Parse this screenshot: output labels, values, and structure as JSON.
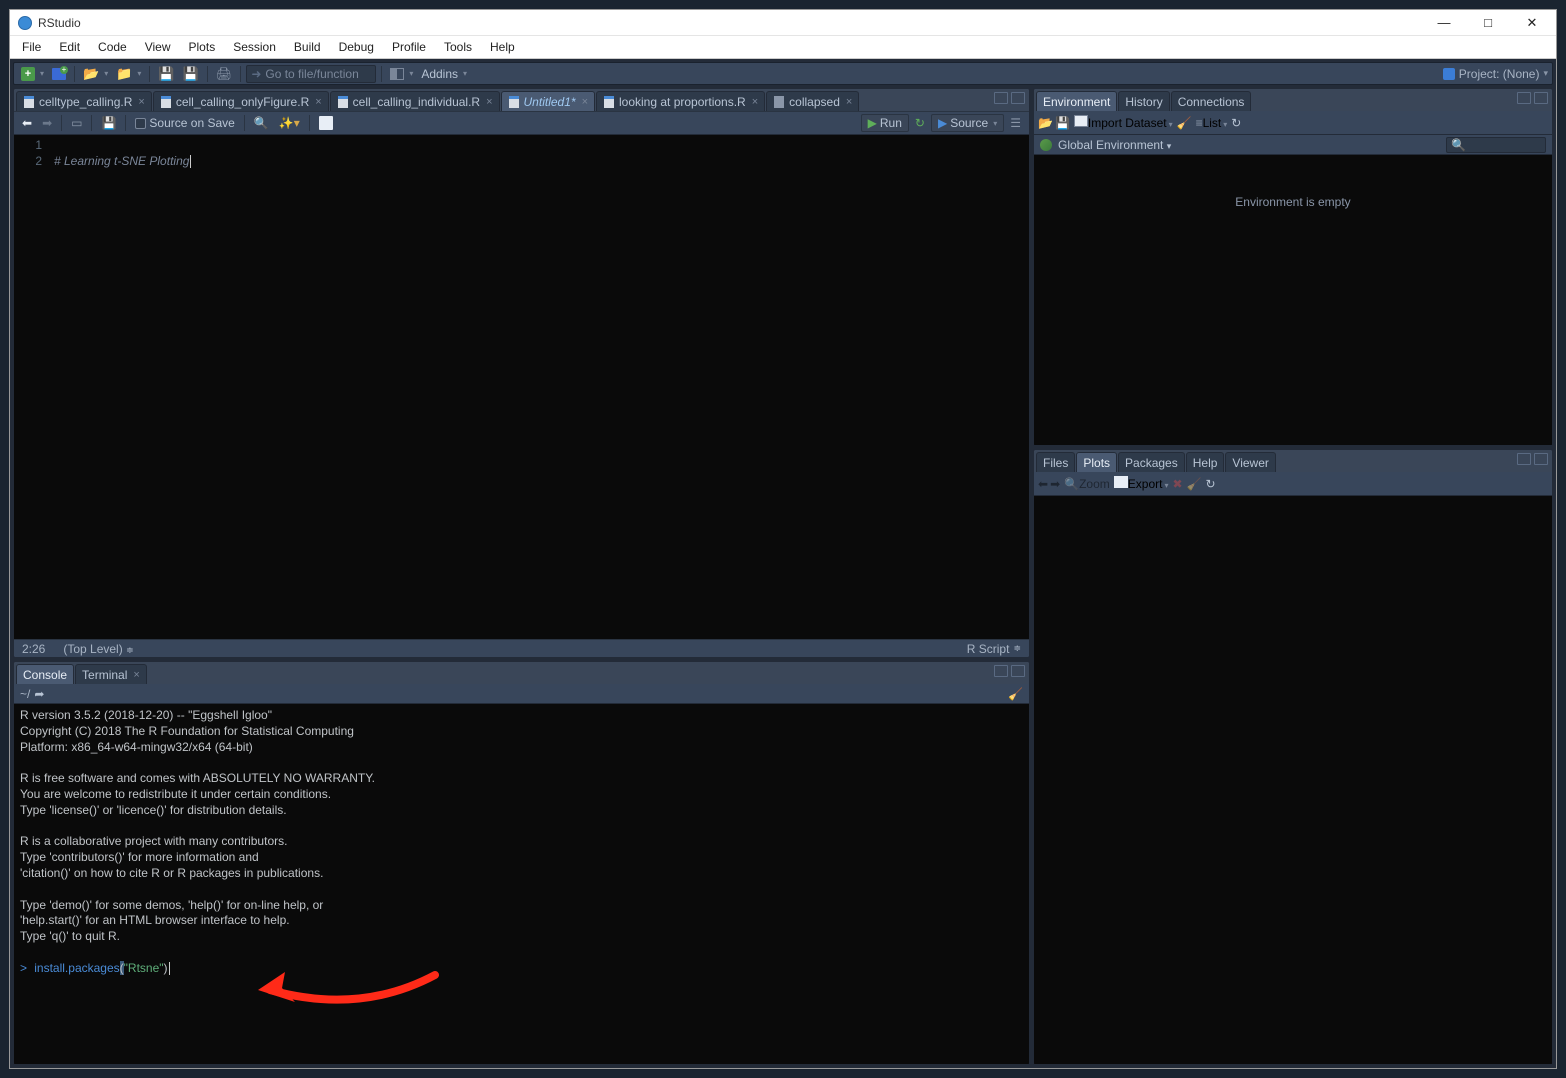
{
  "window": {
    "title": "RStudio"
  },
  "menu": [
    "File",
    "Edit",
    "Code",
    "View",
    "Plots",
    "Session",
    "Build",
    "Debug",
    "Profile",
    "Tools",
    "Help"
  ],
  "toolbar": {
    "goto_placeholder": "Go to file/function",
    "addins": "Addins",
    "project_label": "Project: (None)"
  },
  "editor": {
    "tabs": [
      {
        "label": "celltype_calling.R"
      },
      {
        "label": "cell_calling_onlyFigure.R"
      },
      {
        "label": "cell_calling_individual.R"
      },
      {
        "label": "Untitled1*",
        "active": true
      },
      {
        "label": "looking at proportions.R"
      },
      {
        "label": "collapsed",
        "collapsed": true
      }
    ],
    "source_on_save": "Source on Save",
    "run_label": "Run",
    "source_label": "Source",
    "line_numbers": [
      "1",
      "2"
    ],
    "code_line": "# Learning t-SNE Plotting",
    "status_pos": "2:26",
    "status_scope": "(Top Level)",
    "status_lang": "R Script"
  },
  "console": {
    "tabs": [
      "Console",
      "Terminal"
    ],
    "path": "~/",
    "banner": "R version 3.5.2 (2018-12-20) -- \"Eggshell Igloo\"\nCopyright (C) 2018 The R Foundation for Statistical Computing\nPlatform: x86_64-w64-mingw32/x64 (64-bit)\n\nR is free software and comes with ABSOLUTELY NO WARRANTY.\nYou are welcome to redistribute it under certain conditions.\nType 'license()' or 'licence()' for distribution details.\n\nR is a collaborative project with many contributors.\nType 'contributors()' for more information and\n'citation()' on how to cite R or R packages in publications.\n\nType 'demo()' for some demos, 'help()' for on-line help, or\n'help.start()' for an HTML browser interface to help.\nType 'q()' to quit R.\n",
    "prompt": ">",
    "cmd_fn": "install.packages",
    "cmd_open": "(",
    "cmd_arg": "\"Rtsne\"",
    "cmd_close": ")"
  },
  "env": {
    "tabs": [
      "Environment",
      "History",
      "Connections"
    ],
    "import_label": "Import Dataset",
    "list_label": "List",
    "scope_label": "Global Environment",
    "empty": "Environment is empty"
  },
  "plots": {
    "tabs": [
      "Files",
      "Plots",
      "Packages",
      "Help",
      "Viewer"
    ],
    "zoom": "Zoom",
    "export": "Export"
  }
}
